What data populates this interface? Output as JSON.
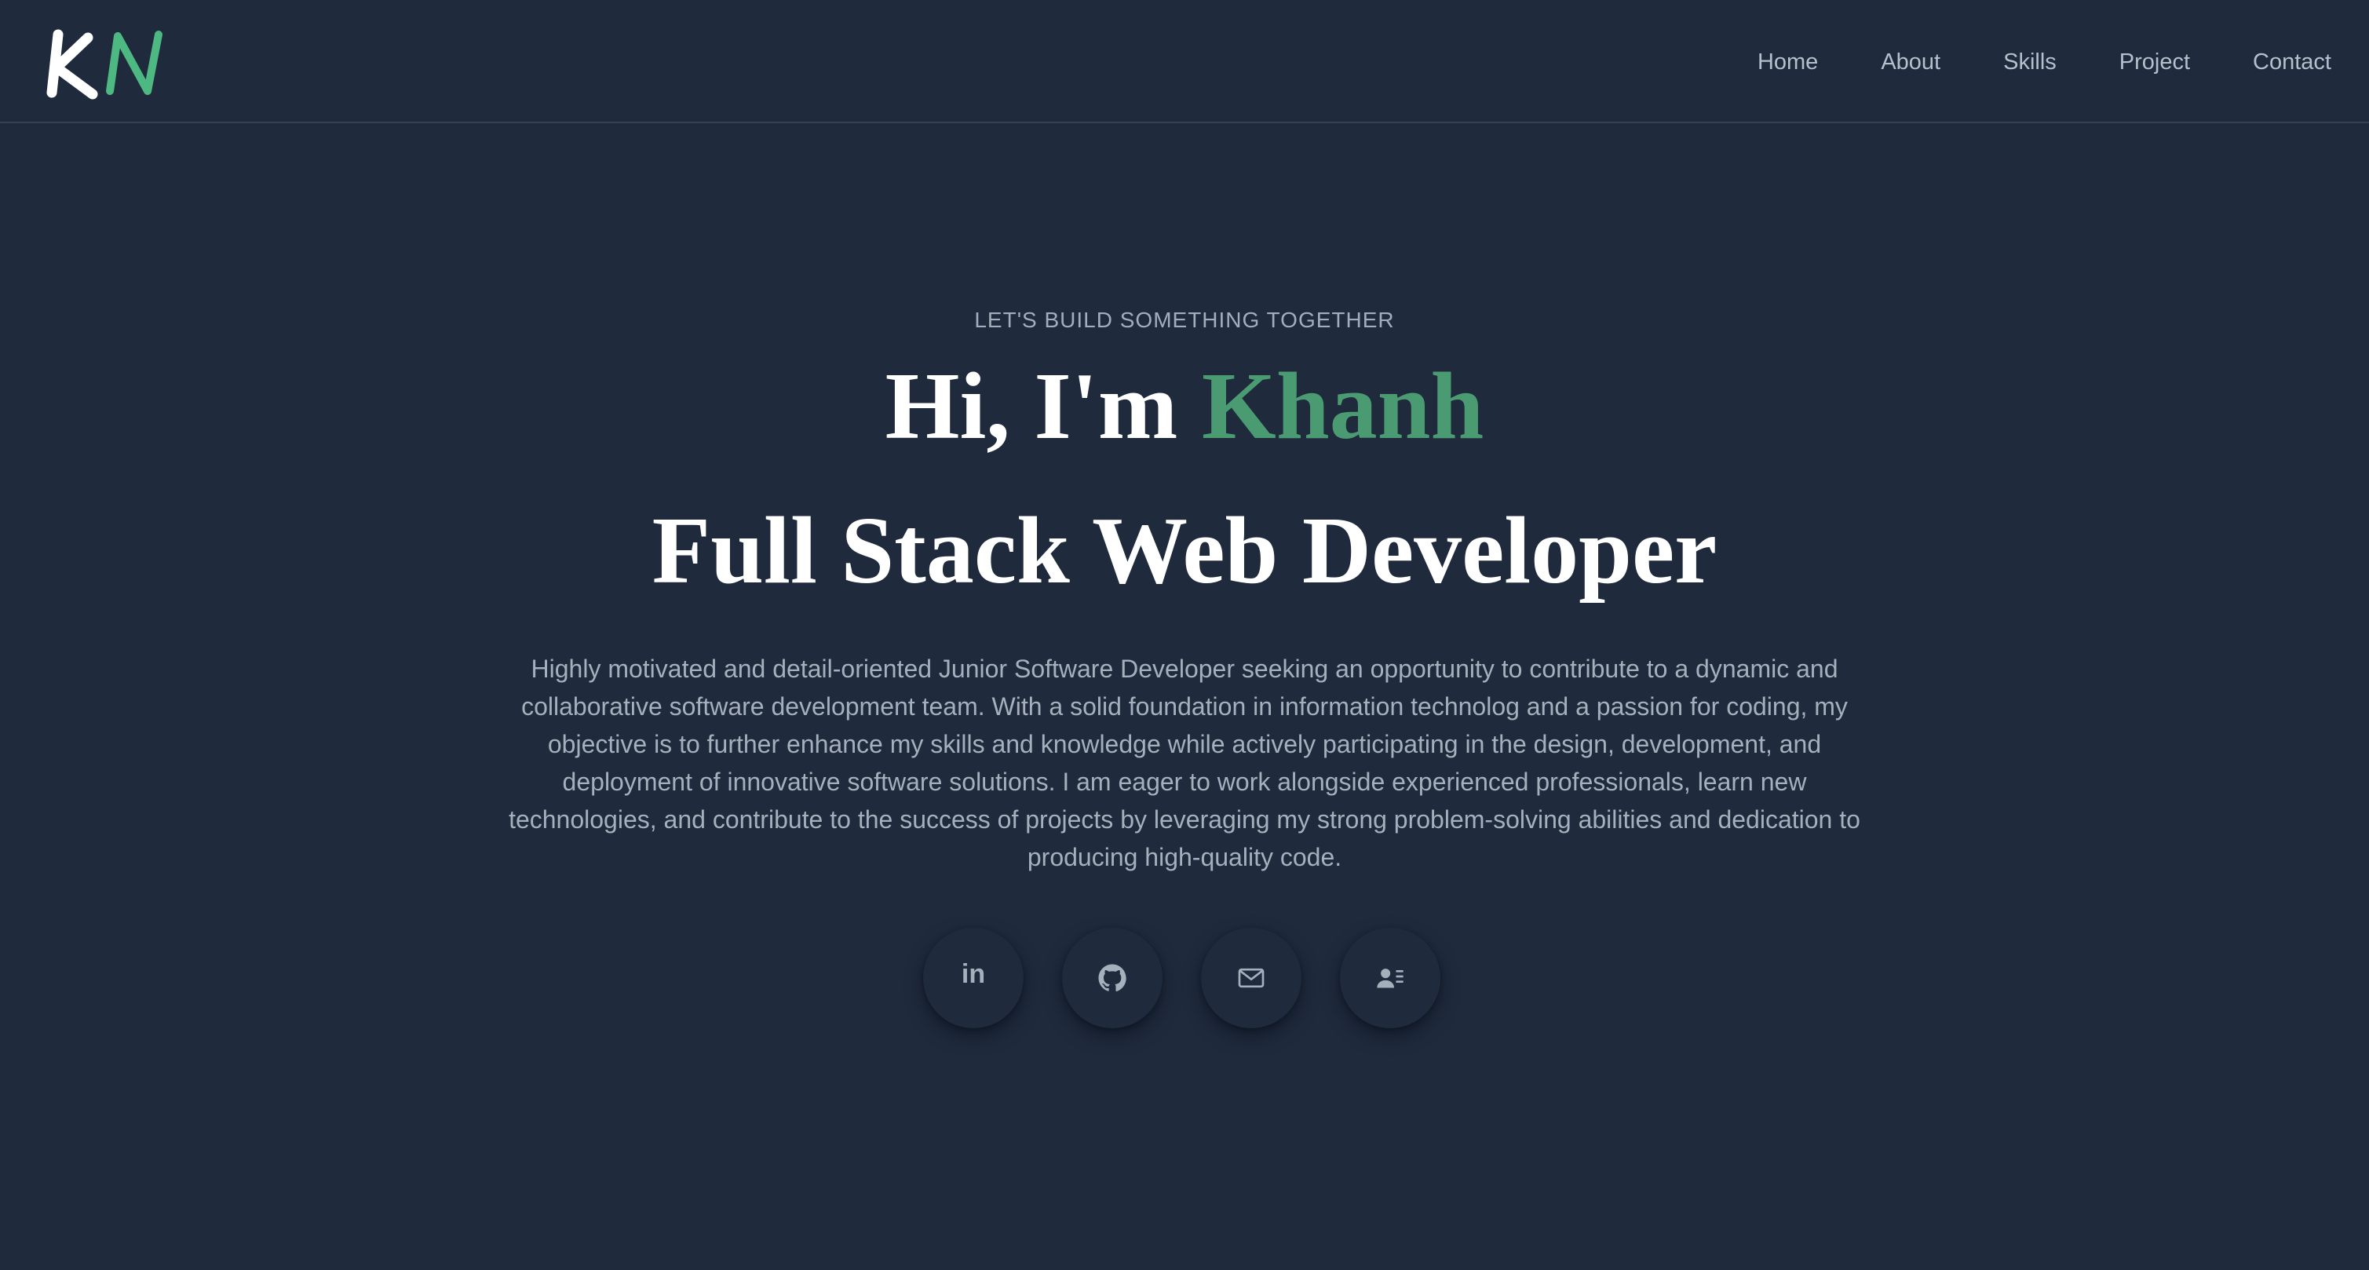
{
  "brand": {
    "logo_text": "KN"
  },
  "nav": {
    "items": [
      {
        "label": "Home"
      },
      {
        "label": "About"
      },
      {
        "label": "Skills"
      },
      {
        "label": "Project"
      },
      {
        "label": "Contact"
      }
    ]
  },
  "hero": {
    "kicker": "LET'S BUILD SOMETHING TOGETHER",
    "greeting_prefix": "Hi, I'm ",
    "greeting_name": "Khanh",
    "role": "Full Stack Web Developer",
    "summary": "Highly motivated and detail-oriented Junior Software Developer seeking an opportunity to contribute to a dynamic and collaborative software development team. With a solid foundation in information technolog and a passion for coding, my objective is to further enhance my skills and knowledge while actively participating in the design, development, and deployment of innovative software solutions. I am eager to work alongside experienced professionals, learn new technologies, and contribute to the success of projects by leveraging my strong problem-solving abilities and dedication to producing high-quality code."
  },
  "socials": {
    "linkedin_text": "in",
    "icons": [
      "linkedin-icon",
      "github-icon",
      "mail-icon",
      "contact-card-icon"
    ]
  },
  "colors": {
    "background": "#1f2a3c",
    "accent": "#4a9b71",
    "nav_text": "#b6bfcc",
    "body_text": "#a6afbc"
  }
}
